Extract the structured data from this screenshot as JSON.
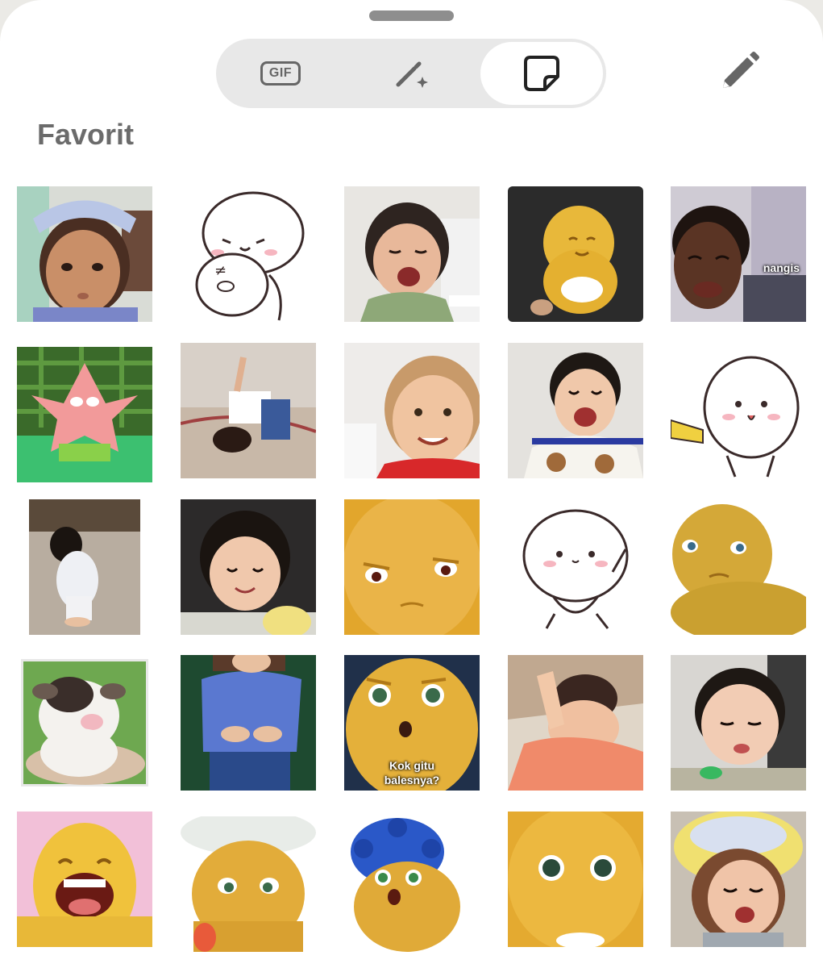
{
  "toolbar": {
    "tabs": [
      {
        "id": "gif",
        "label": "GIF",
        "icon": "gif-icon",
        "selected": false
      },
      {
        "id": "ai",
        "label": "",
        "icon": "magic-wand-icon",
        "selected": false
      },
      {
        "id": "sticker",
        "label": "",
        "icon": "sticker-icon",
        "selected": true
      }
    ],
    "edit_icon": "pencil-icon"
  },
  "section": {
    "title": "Favorit"
  },
  "stickers": [
    {
      "kind": "photo-baby"
    },
    {
      "kind": "cartoon-blob-duo"
    },
    {
      "kind": "photo-baby-crying"
    },
    {
      "kind": "yellow-toy"
    },
    {
      "kind": "photo-crying",
      "caption": "nangis"
    },
    {
      "kind": "cartoon-starfish"
    },
    {
      "kind": "photo-child-floor"
    },
    {
      "kind": "photo-toddler-smile"
    },
    {
      "kind": "photo-baby-laugh"
    },
    {
      "kind": "cartoon-blob-arm"
    },
    {
      "kind": "photo-toddler-standing"
    },
    {
      "kind": "photo-baby-smile"
    },
    {
      "kind": "yellow-face-closeup"
    },
    {
      "kind": "cartoon-blob-dance"
    },
    {
      "kind": "yellow-character-side"
    },
    {
      "kind": "cartoon-cow"
    },
    {
      "kind": "photo-child-blue-shirt"
    },
    {
      "kind": "yellow-character-surprised",
      "caption": "Kok gitu\nbalesnya?"
    },
    {
      "kind": "photo-baby-clap"
    },
    {
      "kind": "photo-baby-pout"
    },
    {
      "kind": "yellow-character-laugh"
    },
    {
      "kind": "yellow-character-hat"
    },
    {
      "kind": "yellow-character-blue-hair"
    },
    {
      "kind": "yellow-face-eyes"
    },
    {
      "kind": "photo-baby-helmet"
    }
  ],
  "colors": {
    "accent": "#222222",
    "tab_track": "#e8e8e8",
    "title": "#6b6b6b",
    "icon": "#666666",
    "yellow_character": "#e8b83a"
  }
}
